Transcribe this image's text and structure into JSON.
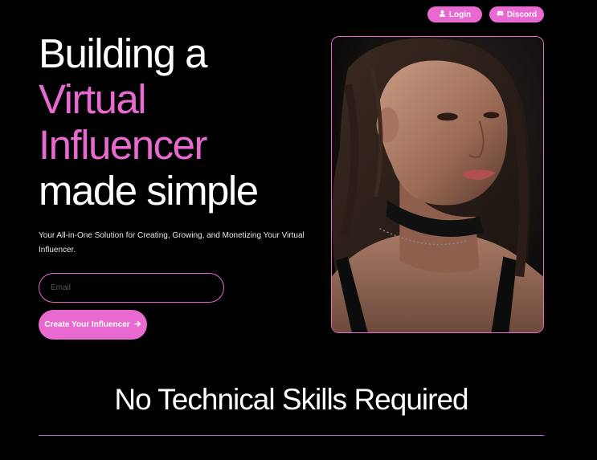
{
  "nav": {
    "login_label": "Login",
    "discord_label": "Discord"
  },
  "hero": {
    "title_line1": "Building a",
    "title_line2": "Virtual",
    "title_line3": "Influencer",
    "title_line4": "made simple",
    "subtitle": "Your All-in-One Solution for Creating, Growing, and Monetizing Your Virtual Influencer.",
    "email_placeholder": "Email",
    "email_value": "",
    "cta_label": "Create Your Influencer"
  },
  "section": {
    "title": "No Technical Skills Required"
  },
  "colors": {
    "accent": "#e86ad1",
    "background": "#000000",
    "text": "#ffffff"
  },
  "icons": {
    "login": "user-icon",
    "discord": "discord-icon",
    "cta": "arrow-right-icon"
  }
}
